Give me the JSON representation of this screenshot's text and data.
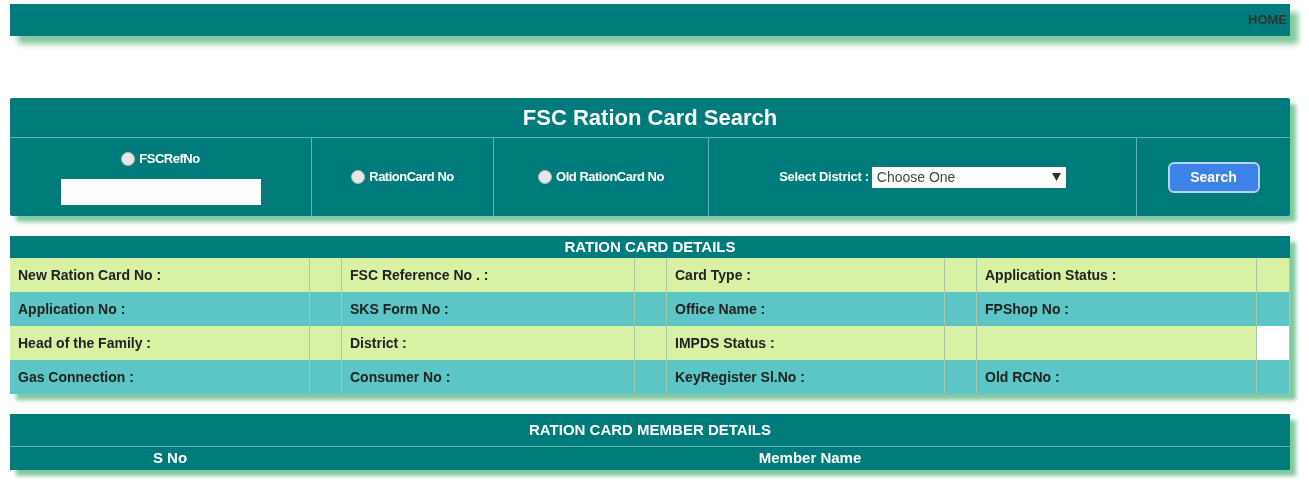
{
  "top_link": "HOME",
  "search_panel": {
    "title": "FSC Ration Card Search",
    "options": [
      {
        "label": "FSCRefNo",
        "selected": false,
        "kind": "field"
      },
      {
        "label": "RationCard No",
        "selected": false,
        "kind": "plain"
      },
      {
        "label": "Old RationCard No",
        "selected": false,
        "kind": "plain"
      }
    ],
    "district_label": "Select District :",
    "district_value": "Choose One",
    "search_button": "Search"
  },
  "details": {
    "title": "RATION CARD DETAILS",
    "rows": [
      {
        "color": "#d8f1a4",
        "labels": [
          "New Ration Card No :",
          "FSC Reference No . :",
          "Card Type :",
          "Application Status :"
        ]
      },
      {
        "color": "#5cc6c6",
        "labels": [
          "Application No :",
          "SKS Form No :",
          "Office Name :",
          "FPShop No :"
        ]
      },
      {
        "color": "#d8f1a4",
        "labels": [
          "Head of the Family :",
          "District :",
          "IMPDS Status :"
        ]
      },
      {
        "color": "#5cc6c6",
        "labels": [
          "Gas Connection :",
          "Consumer No :",
          "KeyRegister Sl.No :",
          "Old RCNo :"
        ]
      }
    ]
  },
  "members": {
    "title": "RATION CARD MEMBER DETAILS",
    "columns": [
      "S No",
      "Member Name"
    ]
  }
}
